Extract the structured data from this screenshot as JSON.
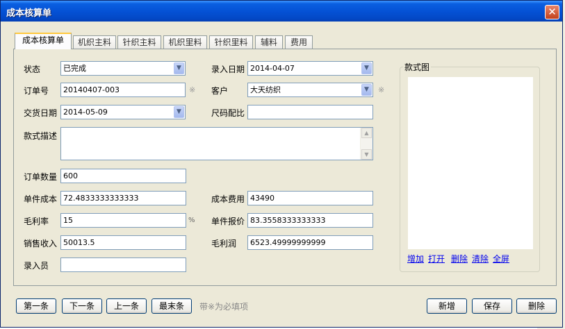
{
  "window": {
    "title": "成本核算单",
    "close": "✕"
  },
  "tabs": [
    {
      "label": "成本核算单",
      "active": true
    },
    {
      "label": "机织主料"
    },
    {
      "label": "针织主料"
    },
    {
      "label": "机织里料"
    },
    {
      "label": "针织里料"
    },
    {
      "label": "辅料"
    },
    {
      "label": "费用"
    }
  ],
  "form": {
    "status": {
      "label": "状态",
      "value": "已完成"
    },
    "entry_date": {
      "label": "录入日期",
      "value": "2014-04-07"
    },
    "order_no": {
      "label": "订单号",
      "value": "20140407-003",
      "required": "※"
    },
    "customer": {
      "label": "客户",
      "value": "大天纺织",
      "required": "※"
    },
    "delivery_date": {
      "label": "交货日期",
      "value": "2014-05-09"
    },
    "size_ratio": {
      "label": "尺码配比",
      "value": ""
    },
    "style_desc": {
      "label": "款式描述",
      "value": ""
    },
    "order_qty": {
      "label": "订单数量",
      "value": "600"
    },
    "unit_cost": {
      "label": "单件成本",
      "value": "72.4833333333333"
    },
    "cost_fee": {
      "label": "成本费用",
      "value": "43490"
    },
    "gross_margin_rate": {
      "label": "毛利率",
      "value": "15",
      "unit": "%"
    },
    "unit_quote": {
      "label": "单件报价",
      "value": "83.3558333333333"
    },
    "sales_revenue": {
      "label": "销售收入",
      "value": "50013.5"
    },
    "gross_profit": {
      "label": "毛利润",
      "value": "6523.49999999999"
    },
    "entered_by": {
      "label": "录入员",
      "value": ""
    }
  },
  "style_image": {
    "title": "款式图",
    "links": [
      "增加",
      "打开",
      "删除",
      "清除",
      "全屏"
    ]
  },
  "nav_buttons": [
    "第一条",
    "下一条",
    "上一条",
    "最末条"
  ],
  "hint": "带※为必填项",
  "action_buttons": [
    "新增",
    "保存",
    "删除"
  ]
}
